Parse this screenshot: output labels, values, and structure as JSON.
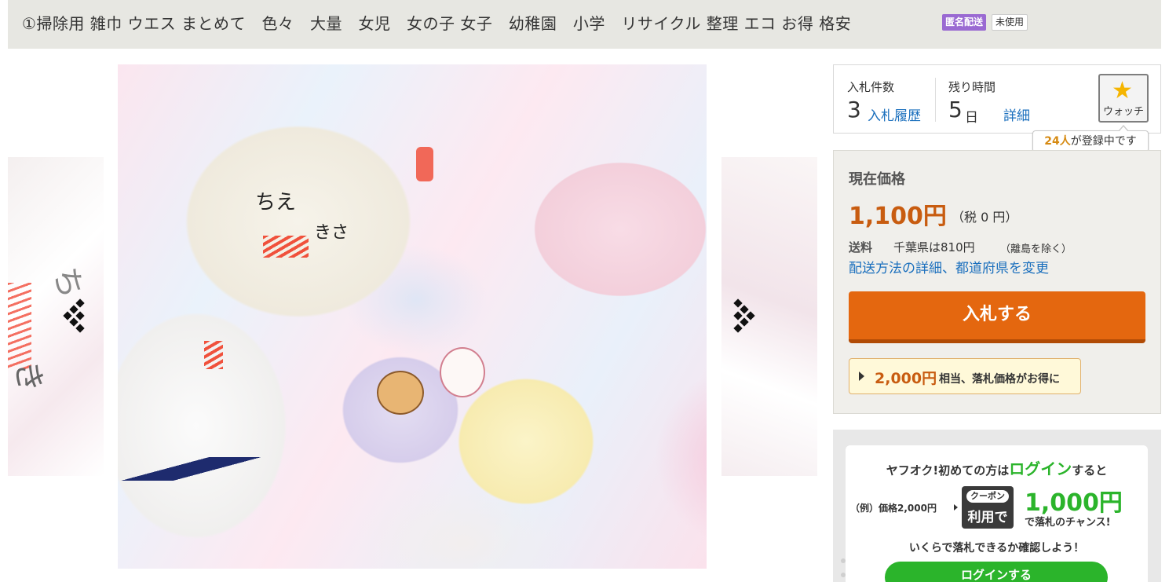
{
  "title": {
    "text": "①掃除用 雑巾 ウエス まとめて　色々　大量　女児　女の子 女子　幼稚園　小学　リサイクル 整理 エコ お得 格安",
    "badge_anonymous": "匿名配送",
    "badge_condition": "未使用"
  },
  "gallery": {
    "photo_text_1": "ちえ",
    "photo_text_2": "きさ",
    "side_text": "ちき"
  },
  "bids": {
    "count_label": "入札件数",
    "count": "3",
    "history_link": "入札履歴",
    "time_label": "残り時間",
    "time_value": "5",
    "time_unit": "日",
    "detail_link": "詳細"
  },
  "watch": {
    "label": "ウォッチ",
    "count": "24人",
    "tip_suffix": "が登録中です"
  },
  "price": {
    "heading": "現在価格",
    "amount": "1,100円",
    "tax": "（税 0 円）",
    "shipping_label": "送料",
    "shipping_value": "千葉県は810円",
    "shipping_note": "（離島を除く）",
    "shipping_link": "配送方法の詳細、都道府県を変更",
    "bid_button": "入札する",
    "promo_price": "2,000円",
    "promo_text": "相当、落札価格がお得に"
  },
  "login_banner": {
    "line1_prefix": "ヤフオク!初めての方は",
    "line1_highlight": "ログイン",
    "line1_suffix": "すると",
    "example": "（例）価格2,000円",
    "coupon_top": "クーポン",
    "coupon_bottom": "利用で",
    "discount_amount": "1,000円",
    "discount_text": "で落札のチャンス!",
    "line3": "いくらで落札できるか確認しよう！",
    "button": "ログインする"
  },
  "colors": {
    "accent_orange": "#e4670f",
    "price_orange": "#c85c10",
    "link_blue": "#1a6fbd",
    "login_green": "#2bb42b",
    "badge_purple": "#9a6ad2"
  }
}
